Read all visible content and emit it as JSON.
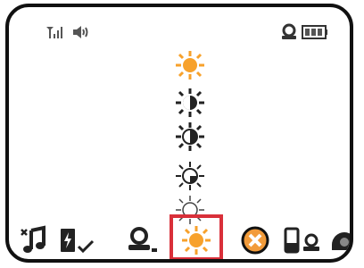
{
  "device": {
    "status_bar": {
      "left_icons": [
        "signal-icon",
        "volume-icon"
      ],
      "right_icons": [
        "headset-status-icon",
        "battery-icon"
      ]
    },
    "brightness_levels": [
      {
        "icon": "sun-bright-icon",
        "selected": true
      },
      {
        "icon": "sun-dark-icon",
        "selected": false
      },
      {
        "icon": "sun-half-icon",
        "selected": false
      },
      {
        "icon": "sun-quarter-icon",
        "selected": false
      },
      {
        "icon": "sun-outline-icon",
        "selected": false
      }
    ],
    "menu": {
      "items": [
        {
          "icon": "music-note-icon"
        },
        {
          "icon": "battery-charged-icon"
        },
        {
          "icon": "headset-icon"
        },
        {
          "icon": "brightness-icon",
          "selected": true
        },
        {
          "icon": "cancel-circle-icon"
        },
        {
          "icon": "phone-headset-icon"
        },
        {
          "icon": "helmet-icon"
        }
      ]
    },
    "colors": {
      "accent": "#f7a12b",
      "selection": "#d9303a",
      "icon": "#222222",
      "cancel_fill": "#f29b3a"
    }
  }
}
